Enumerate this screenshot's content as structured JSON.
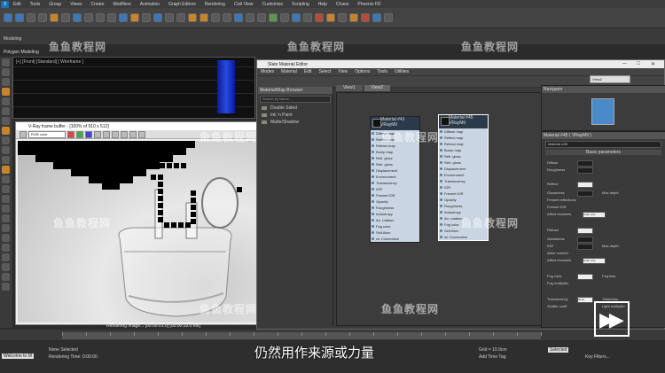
{
  "app": {
    "menu": [
      "Edit",
      "Tools",
      "Group",
      "Views",
      "Create",
      "Modifiers",
      "Animation",
      "Graph Editors",
      "Rendering",
      "Civil View",
      "Customize",
      "Scripting",
      "Help",
      "Chaos",
      "Phoenix FD"
    ],
    "ribbon_label": "Modeling",
    "ribbon_sub": "Polygon Modeling",
    "viewport_label": "[+] [Front] [Standard] [ Wireframe ]"
  },
  "vfb": {
    "title": "V-Ray frame buffer - [100% of 910 x 512]",
    "combo": "RGB color",
    "status": "Rendering image... [00:00:01.0] [00:00:33.0 est]"
  },
  "sme": {
    "title": "Slate Material Editor",
    "menu": [
      "Modes",
      "Material",
      "Edit",
      "Select",
      "View",
      "Options",
      "Tools",
      "Utilities"
    ],
    "view_dropdown": "View2",
    "browser_title": "Material/Map Browser",
    "browser_search": "Search by Name ...",
    "browser_items": [
      "Double Sided",
      "Ink 'n Paint",
      "Matte/Shadow"
    ],
    "view_tabs": [
      "View1",
      "View2"
    ],
    "node1": {
      "name": "Material #41",
      "type": "VRayMtl"
    },
    "node2": {
      "name": "Material #45",
      "type": "VRayMtl"
    },
    "slots": [
      "Diffuse map",
      "Reflect map",
      "Refract map",
      "Bump map",
      "Refl. gloss",
      "Refr. gloss",
      "Displacement",
      "Environment",
      "Translucency",
      "IOR",
      "Fresnel IOR",
      "Opacity",
      "Roughness",
      "Anisotropy",
      "An. rotation",
      "Fog color",
      "Self-illum"
    ],
    "slot_footer": "mr Connection",
    "navigator_title": "Navigator",
    "props_title": "Material #45  ( VRayMtl )",
    "props_name": "Material #45",
    "rollout_basic": "Basic parameters",
    "labels": {
      "diffuse": "Diffuse",
      "roughness": "Roughness",
      "reflect": "Reflect",
      "gloss": "Glossiness",
      "fresnel": "Fresnel reflections",
      "fresnel_ior": "Fresnel IOR",
      "max_depth": "Max depth",
      "affect": "Affect channels",
      "refract": "Refract",
      "ior": "IOR",
      "abbe": "Abbe number",
      "fog_color": "Fog color",
      "fog_mult": "Fog multiplier",
      "fog_bias": "Fog bias",
      "translucency": "Translucency",
      "scatter": "Scatter coeff",
      "thickness": "Thickness",
      "color_only": "Color only",
      "light_mult": "Light multiplier",
      "none": "None"
    }
  },
  "bottom": {
    "welcome": "Welcome to M",
    "status1": "None Selected",
    "status2": "Rendering Time: 0:00:00",
    "grid": "Grid = 10.0cm",
    "add_time_tag": "Add Time Tag",
    "selected": "Selected",
    "key_filters": "Key Filters..."
  },
  "subtitle": "仍然用作来源或力量",
  "watermark": "鱼鱼教程网"
}
